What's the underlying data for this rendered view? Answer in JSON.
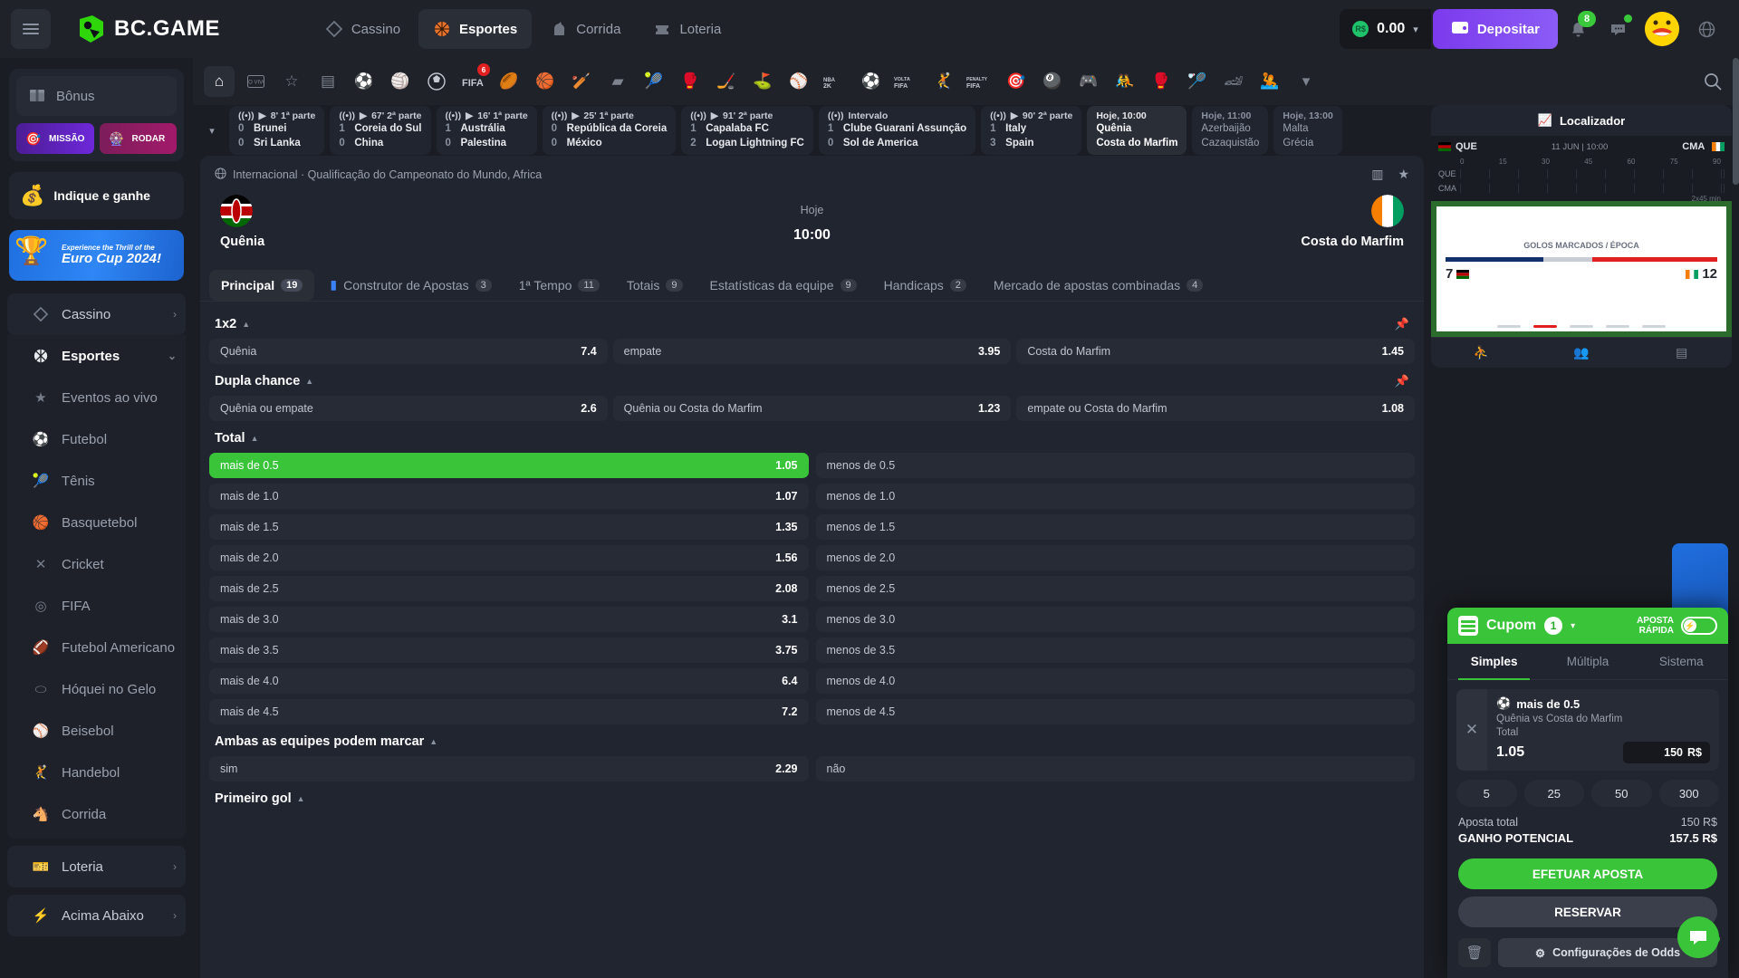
{
  "brand": {
    "name": "BC.GAME",
    "logo_icon": "bc-game-logo"
  },
  "topnav": {
    "items": [
      {
        "label": "Cassino",
        "icon": "cards-icon",
        "active": false
      },
      {
        "label": "Esportes",
        "icon": "basketball-icon",
        "active": true
      },
      {
        "label": "Corrida",
        "icon": "horse-icon",
        "active": false
      },
      {
        "label": "Loteria",
        "icon": "ticket-icon",
        "active": false
      }
    ]
  },
  "wallet": {
    "amount": "0.00",
    "currency_icon": "brl-coin",
    "deposit_label": "Depositar",
    "wallet_icon": "wallet-icon"
  },
  "top_right": {
    "notification_badge": "8",
    "bell_icon": "bell-icon",
    "chat_icon": "chat-icon",
    "avatar_icon": "user-avatar",
    "language_icon": "globe-icon"
  },
  "sidebar": {
    "bonus": {
      "label": "Bônus",
      "icon": "gift-icon"
    },
    "mission": {
      "label": "MISSÃO",
      "icon": "target-icon"
    },
    "spin": {
      "label": "RODAR",
      "icon": "wheel-icon"
    },
    "refer": {
      "label": "Indique e ganhe",
      "icon": "treasure-icon"
    },
    "banner": {
      "line1": "Experience the Thrill of the",
      "line2": "Euro Cup 2024!",
      "icon": "trophy-icon"
    },
    "groups": [
      {
        "label": "Cassino",
        "icon": "cards-icon",
        "arrow": "›",
        "expanded": false
      },
      {
        "label": "Esportes",
        "icon": "basketball-icon",
        "arrow": "⌄",
        "expanded": true
      }
    ],
    "sports": [
      {
        "label": "Eventos ao vivo",
        "icon": "live-icon"
      },
      {
        "label": "Futebol",
        "icon": "soccer-icon"
      },
      {
        "label": "Tênis",
        "icon": "tennis-icon"
      },
      {
        "label": "Basquetebol",
        "icon": "basketball-icon"
      },
      {
        "label": "Cricket",
        "icon": "cricket-icon"
      },
      {
        "label": "FIFA",
        "icon": "fifa-icon"
      },
      {
        "label": "Futebol Americano",
        "icon": "football-icon"
      },
      {
        "label": "Hóquei no Gelo",
        "icon": "hockey-icon"
      },
      {
        "label": "Beisebol",
        "icon": "baseball-icon"
      },
      {
        "label": "Handebol",
        "icon": "handball-icon"
      },
      {
        "label": "Corrida",
        "icon": "horse-icon"
      }
    ],
    "bottom_groups": [
      {
        "label": "Loteria",
        "icon": "lottery-icon",
        "arrow": "›"
      },
      {
        "label": "Acima Abaixo",
        "icon": "bolt-icon",
        "arrow": "›"
      }
    ]
  },
  "sportbar": {
    "icons": [
      "home-icon",
      "live-tv-icon",
      "star-icon",
      "list-icon",
      "soccer-ball-icon",
      "volleyball-icon",
      "soccer-icon",
      "fifa-icon",
      "rugby-icon",
      "basketball-icon",
      "cricket-icon",
      "table-tennis-icon",
      "tennis-icon",
      "ufc-icon",
      "hockey-icon",
      "golf-icon",
      "baseball-icon",
      "nba2k-icon",
      "soccer2-icon",
      "volta-fifa-icon",
      "handball-icon",
      "penalty-fifa-icon",
      "darts-icon",
      "snooker-icon",
      "esports-icon",
      "kabaddi-icon",
      "boxing-icon",
      "badminton-icon",
      "motorsport-icon",
      "waterpolo-icon"
    ],
    "fifa_badge": "6",
    "chevron": "chevron-down-icon",
    "search_icon": "search-icon"
  },
  "livebar": {
    "caret": "chevron-down-icon",
    "matches": [
      {
        "status": "8' 1ª parte",
        "live": true,
        "home": "Brunei",
        "away": "Sri Lanka",
        "home_score": "0",
        "away_score": "0"
      },
      {
        "status": "67' 2ª parte",
        "live": true,
        "home": "Coreia do Sul",
        "away": "China",
        "home_score": "1",
        "away_score": "0"
      },
      {
        "status": "16' 1ª parte",
        "live": true,
        "home": "Austrália",
        "away": "Palestina",
        "home_score": "1",
        "away_score": "0"
      },
      {
        "status": "25' 1ª parte",
        "live": true,
        "home": "República da Coreia",
        "away": "México",
        "home_score": "0",
        "away_score": "0"
      },
      {
        "status": "91' 2ª parte",
        "live": true,
        "home": "Capalaba FC",
        "away": "Logan Lightning FC",
        "home_score": "1",
        "away_score": "2"
      },
      {
        "status": "Intervalo",
        "live": true,
        "home": "Clube Guarani Assunção",
        "away": "Sol de America",
        "home_score": "1",
        "away_score": "0"
      },
      {
        "status": "90' 2ª parte",
        "live": true,
        "home": "Italy",
        "away": "Spain",
        "home_score": "1",
        "away_score": "3"
      }
    ],
    "upcoming": [
      {
        "status": "Hoje, 10:00",
        "home": "Quênia",
        "away": "Costa do Marfim",
        "selected": true
      },
      {
        "status": "Hoje, 11:00",
        "home": "Azerbaijão",
        "away": "Cazaquistão",
        "selected": false
      },
      {
        "status": "Hoje, 13:00",
        "home": "Malta",
        "away": "Grécia",
        "selected": false
      }
    ]
  },
  "match": {
    "breadcrumb_icon": "globe-icon",
    "breadcrumb": "Internacional · Qualificação do Campeonato do Mundo, Africa",
    "stats_icon": "stats-icon",
    "star_icon": "star-icon",
    "home_team": "Quênia",
    "away_team": "Costa do Marfim",
    "day": "Hoje",
    "time": "10:00"
  },
  "tabs": [
    {
      "label": "Principal",
      "count": "19",
      "active": true,
      "icon": ""
    },
    {
      "label": "Construtor de Apostas",
      "count": "3",
      "active": false,
      "icon": "builder-icon"
    },
    {
      "label": "1ª Tempo",
      "count": "11",
      "active": false,
      "icon": ""
    },
    {
      "label": "Totais",
      "count": "9",
      "active": false,
      "icon": ""
    },
    {
      "label": "Estatísticas da equipe",
      "count": "9",
      "active": false,
      "icon": ""
    },
    {
      "label": "Handicaps",
      "count": "2",
      "active": false,
      "icon": ""
    },
    {
      "label": "Mercado de apostas combinadas",
      "count": "4",
      "active": false,
      "icon": ""
    }
  ],
  "markets": [
    {
      "title": "1x2",
      "caret": "▲",
      "pin": "pin-icon",
      "layout": "three",
      "odds": [
        {
          "label": "Quênia",
          "value": "7.4",
          "selected": false
        },
        {
          "label": "empate",
          "value": "3.95",
          "selected": false
        },
        {
          "label": "Costa do Marfim",
          "value": "1.45",
          "selected": false
        }
      ]
    },
    {
      "title": "Dupla chance",
      "caret": "▲",
      "pin": "pin-icon",
      "layout": "three",
      "odds": [
        {
          "label": "Quênia ou empate",
          "value": "2.6",
          "selected": false
        },
        {
          "label": "Quênia ou Costa do Marfim",
          "value": "1.23",
          "selected": false
        },
        {
          "label": "empate ou Costa do Marfim",
          "value": "1.08",
          "selected": false
        }
      ]
    },
    {
      "title": "Total",
      "caret": "▲",
      "pin": "pin-icon",
      "layout": "two",
      "pairs": [
        {
          "over_label": "mais de 0.5",
          "over_value": "1.05",
          "over_selected": true,
          "under_label": "menos de 0.5",
          "under_value": ""
        },
        {
          "over_label": "mais de 1.0",
          "over_value": "1.07",
          "over_selected": false,
          "under_label": "menos de 1.0",
          "under_value": ""
        },
        {
          "over_label": "mais de 1.5",
          "over_value": "1.35",
          "over_selected": false,
          "under_label": "menos de 1.5",
          "under_value": ""
        },
        {
          "over_label": "mais de 2.0",
          "over_value": "1.56",
          "over_selected": false,
          "under_label": "menos de 2.0",
          "under_value": ""
        },
        {
          "over_label": "mais de 2.5",
          "over_value": "2.08",
          "over_selected": false,
          "under_label": "menos de 2.5",
          "under_value": ""
        },
        {
          "over_label": "mais de 3.0",
          "over_value": "3.1",
          "over_selected": false,
          "under_label": "menos de 3.0",
          "under_value": ""
        },
        {
          "over_label": "mais de 3.5",
          "over_value": "3.75",
          "over_selected": false,
          "under_label": "menos de 3.5",
          "under_value": ""
        },
        {
          "over_label": "mais de 4.0",
          "over_value": "6.4",
          "over_selected": false,
          "under_label": "menos de 4.0",
          "under_value": ""
        },
        {
          "over_label": "mais de 4.5",
          "over_value": "7.2",
          "over_selected": false,
          "under_label": "menos de 4.5",
          "under_value": ""
        }
      ]
    },
    {
      "title": "Ambas as equipes podem marcar",
      "caret": "▲",
      "pin": "pin-icon",
      "layout": "two",
      "pairs": [
        {
          "over_label": "sim",
          "over_value": "2.29",
          "over_selected": false,
          "under_label": "não",
          "under_value": ""
        }
      ]
    },
    {
      "title": "Primeiro gol",
      "caret": "▲",
      "pin": "pin-icon",
      "layout": "none"
    }
  ],
  "locator": {
    "title": "Localizador",
    "icon": "chart-icon",
    "home_code": "QUE",
    "away_code": "CMA",
    "date": "11 JUN | 10:00",
    "axis_ticks": [
      "0",
      "15",
      "30",
      "45",
      "60",
      "75",
      "90"
    ],
    "rows": [
      "QUE",
      "CMA"
    ],
    "duration_note": "2x45 min",
    "pitch_label": "GOLOS MARCADOS / ÉPOCA",
    "home_goals": "7",
    "away_goals": "12",
    "tabs": [
      "pitch-icon",
      "lineup-icon",
      "table-icon"
    ]
  },
  "betslip": {
    "title": "Cupom",
    "count": "1",
    "caret": "▾",
    "slip_icon": "receipt-icon",
    "quick_bet_label_line1": "APOSTA",
    "quick_bet_label_line2": "RÁPIDA",
    "toggle_icon": "bolt-icon",
    "tabs": [
      {
        "label": "Simples",
        "active": true
      },
      {
        "label": "Múltipla",
        "active": false
      },
      {
        "label": "Sistema",
        "active": false
      }
    ],
    "selection": {
      "close_icon": "close-icon",
      "sport_icon": "soccer-icon",
      "name": "mais de 0.5",
      "match": "Quênia vs Costa do Marfim",
      "market": "Total",
      "odd": "1.05",
      "stake": "150",
      "currency": "R$"
    },
    "quick_amounts": [
      "5",
      "25",
      "50",
      "300"
    ],
    "total_label": "Aposta total",
    "total_value": "150 R$",
    "potential_label": "GANHO POTENCIAL",
    "potential_value": "157.5 R$",
    "place_bet_label": "EFETUAR APOSTA",
    "reserve_label": "RESERVAR",
    "trash_icon": "trash-icon",
    "odds_settings_label": "Configurações de Odds",
    "gear_icon": "gear-icon"
  },
  "fab": {
    "icon": "support-chat-icon"
  },
  "colors": {
    "accent_green": "#39c43a",
    "purple": "#7c3aed",
    "bg": "#1a1d23",
    "panel": "#212530"
  }
}
